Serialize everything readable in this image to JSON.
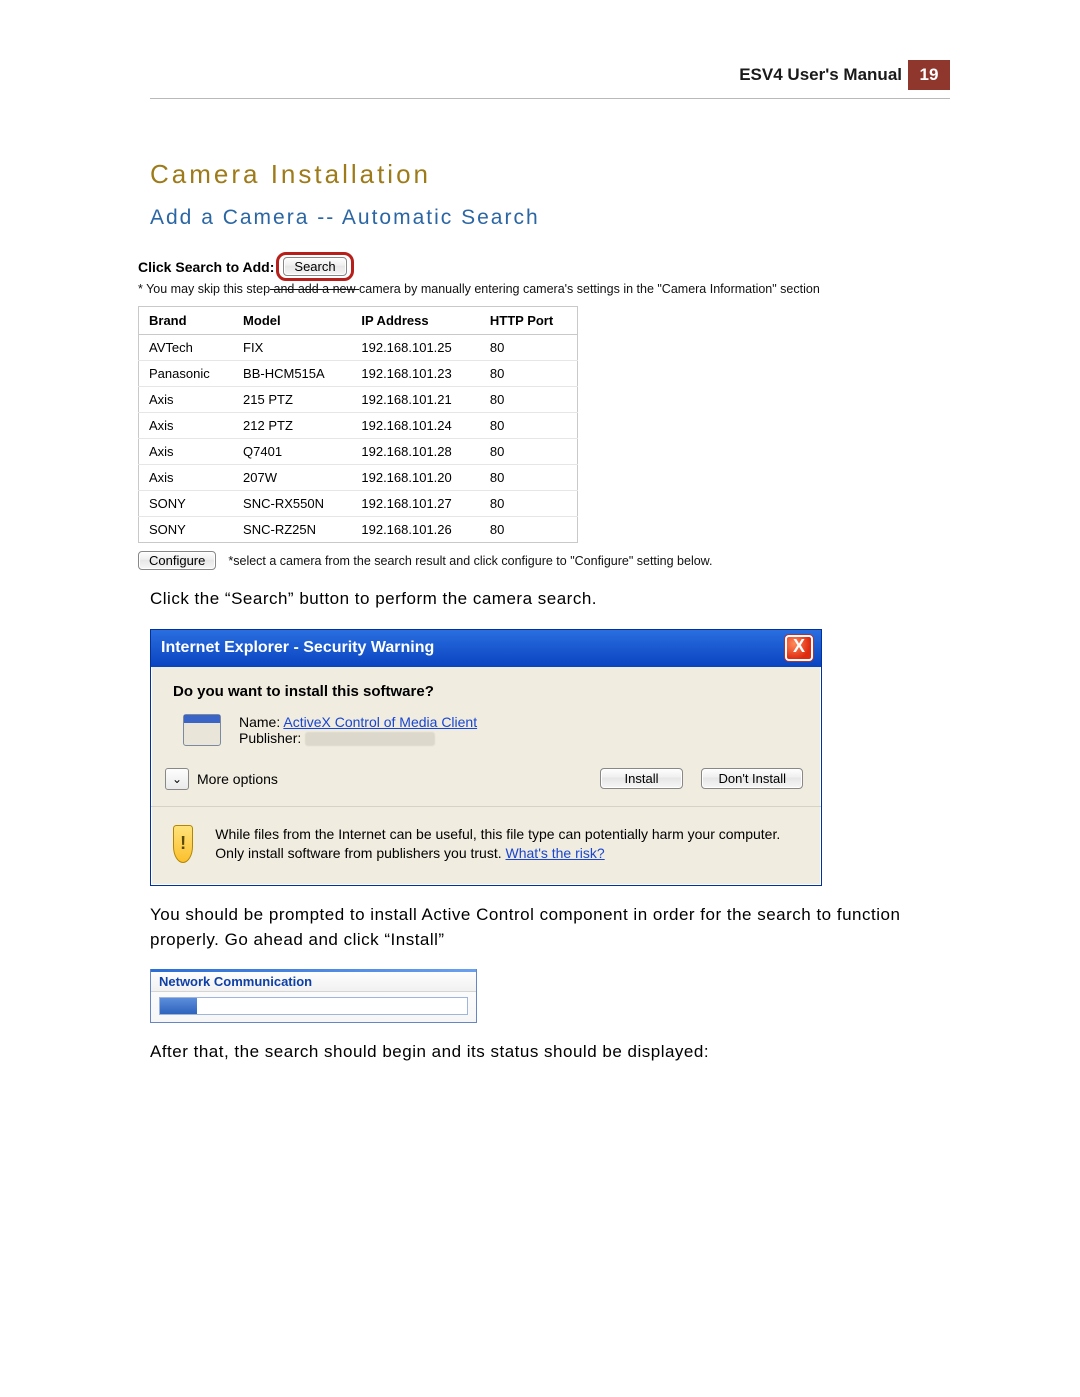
{
  "header": {
    "title": "ESV4 User's Manual",
    "page": "19"
  },
  "section": {
    "title": "Camera Installation",
    "subtitle": "Add a Camera -- Automatic Search"
  },
  "search_block": {
    "label": "Click Search to Add:",
    "button": "Search",
    "skip_prefix": "* You may skip this step",
    "skip_mid": " and add a new ",
    "skip_suffix": "camera by manually entering camera's settings in the \"Camera Information\" section",
    "columns": [
      "Brand",
      "Model",
      "IP Address",
      "HTTP Port"
    ],
    "rows": [
      {
        "brand": "AVTech",
        "model": "FIX",
        "ip": "192.168.101.25",
        "port": "80"
      },
      {
        "brand": "Panasonic",
        "model": "BB-HCM515A",
        "ip": "192.168.101.23",
        "port": "80"
      },
      {
        "brand": "Axis",
        "model": "215 PTZ",
        "ip": "192.168.101.21",
        "port": "80"
      },
      {
        "brand": "Axis",
        "model": "212 PTZ",
        "ip": "192.168.101.24",
        "port": "80"
      },
      {
        "brand": "Axis",
        "model": "Q7401",
        "ip": "192.168.101.28",
        "port": "80"
      },
      {
        "brand": "Axis",
        "model": "207W",
        "ip": "192.168.101.20",
        "port": "80"
      },
      {
        "brand": "SONY",
        "model": "SNC-RX550N",
        "ip": "192.168.101.27",
        "port": "80"
      },
      {
        "brand": "SONY",
        "model": "SNC-RZ25N",
        "ip": "192.168.101.26",
        "port": "80"
      }
    ],
    "configure": "Configure",
    "configure_note": "*select a camera from the search result and click configure to \"Configure\" setting below."
  },
  "para1": "Click the “Search” button to perform the camera search.",
  "ie_dialog": {
    "title": "Internet Explorer - Security Warning",
    "question": "Do you want to install this software?",
    "name_label": "Name:",
    "name_value": "ActiveX Control of Media Client",
    "publisher_label": "Publisher:",
    "more": "More options",
    "install": "Install",
    "dont_install": "Don't Install",
    "warn": "While files from the Internet can be useful, this file type can potentially harm your computer. Only install software from publishers you trust. ",
    "risk": "What's the risk?",
    "close": "X"
  },
  "para2": "You should be prompted to install Active Control component in order for the search to function properly. Go ahead and click “Install”",
  "progress": {
    "title": "Network Communication"
  },
  "para3": "After that, the search should begin and its status should be displayed:"
}
